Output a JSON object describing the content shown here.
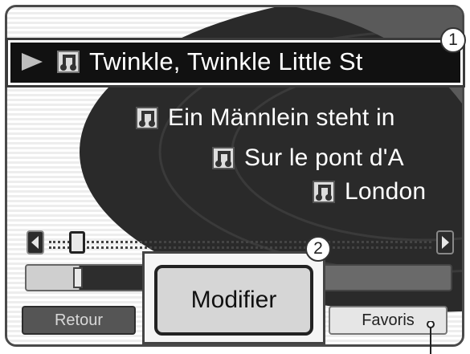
{
  "songs": {
    "selected": "Twinkle, Twinkle Little St",
    "items": [
      "Ein Männlein steht in",
      "Sur le pont d'A",
      "London"
    ]
  },
  "callouts": [
    "1",
    "2"
  ],
  "buttons": {
    "back_label": "Retour",
    "edit_label": "Modifier",
    "favorites_label": "Favoris"
  },
  "scroll": {
    "position": 0.05
  },
  "colors": {
    "selected_bg": "#111111",
    "disc": "#2a2a2a",
    "button_dark": "#555555"
  },
  "icons": [
    "play-icon",
    "music-note-icon",
    "left-arrow-icon",
    "right-arrow-icon"
  ]
}
